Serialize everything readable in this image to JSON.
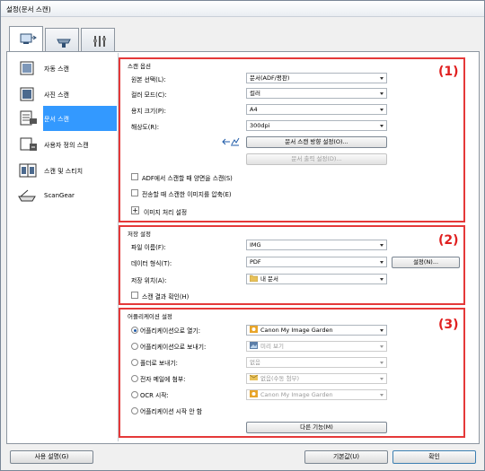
{
  "window": {
    "title": "설정(문서 스캔)"
  },
  "tabs": [
    {
      "name": "scan-settings"
    },
    {
      "name": "scanner-settings"
    },
    {
      "name": "general-settings"
    }
  ],
  "sidebar": {
    "items": [
      {
        "label": "자동 스캔",
        "icon": "auto-scan-icon"
      },
      {
        "label": "사진 스캔",
        "icon": "photo-scan-icon"
      },
      {
        "label": "문서 스캔",
        "icon": "document-scan-icon",
        "selected": true
      },
      {
        "label": "사용자 정의 스캔",
        "icon": "custom-scan-icon"
      },
      {
        "label": "스캔 및 스티치",
        "icon": "scan-stitch-icon"
      },
      {
        "label": "ScanGear",
        "icon": "scangear-icon"
      }
    ]
  },
  "scan_options": {
    "title": "스캔 옵션",
    "number": "(1)",
    "source_label": "원본 선택(L):",
    "source_value": "문서(ADF/평판)",
    "color_label": "컬러 모드(C):",
    "color_value": "컬러",
    "paper_label": "용지 크기(P):",
    "paper_value": "A4",
    "resolution_label": "해상도(R):",
    "resolution_value": "300dpi",
    "orientation_button": "문서 스캔 방향 설정(O)...",
    "output_button": "문서 출력 설정(D)...",
    "duplex_label": "ADF에서 스캔할 때 양면을 스캔(S)",
    "compress_label": "전송할 때 스캔한 이미지를 압축(E)",
    "image_proc_label": "이미지 처리 설정"
  },
  "save_settings": {
    "title": "저장 설정",
    "number": "(2)",
    "filename_label": "파일 이름(F):",
    "filename_value": "IMG",
    "format_label": "데이터 형식(T):",
    "format_value": "PDF",
    "format_settings_button": "설정(N)...",
    "location_label": "저장 위치(A):",
    "location_value": "내 문서",
    "check_results_label": "스캔 결과 확인(H)"
  },
  "app_settings": {
    "title": "어플리케이션 설정",
    "number": "(3)",
    "open_label": "어플리케이션으로 열기:",
    "open_value": "Canon My Image Garden",
    "send_label": "어플리케이션으로 보내기:",
    "send_value": "미리 보기",
    "folder_label": "폴더로 보내기:",
    "folder_value": "없음",
    "email_label": "전자 메일에 첨부:",
    "email_value": "없음(수동 첨부)",
    "ocr_label": "OCR 시작:",
    "ocr_value": "Canon My Image Garden",
    "none_label": "어플리케이션 시작 안 함",
    "more_button": "다른 기능(M)"
  },
  "footer": {
    "help_button": "사용 설명(G)",
    "defaults_button": "기본값(U)",
    "ok_button": "확인"
  },
  "colors": {
    "highlight": "#e53939",
    "selection": "#3399ff"
  }
}
